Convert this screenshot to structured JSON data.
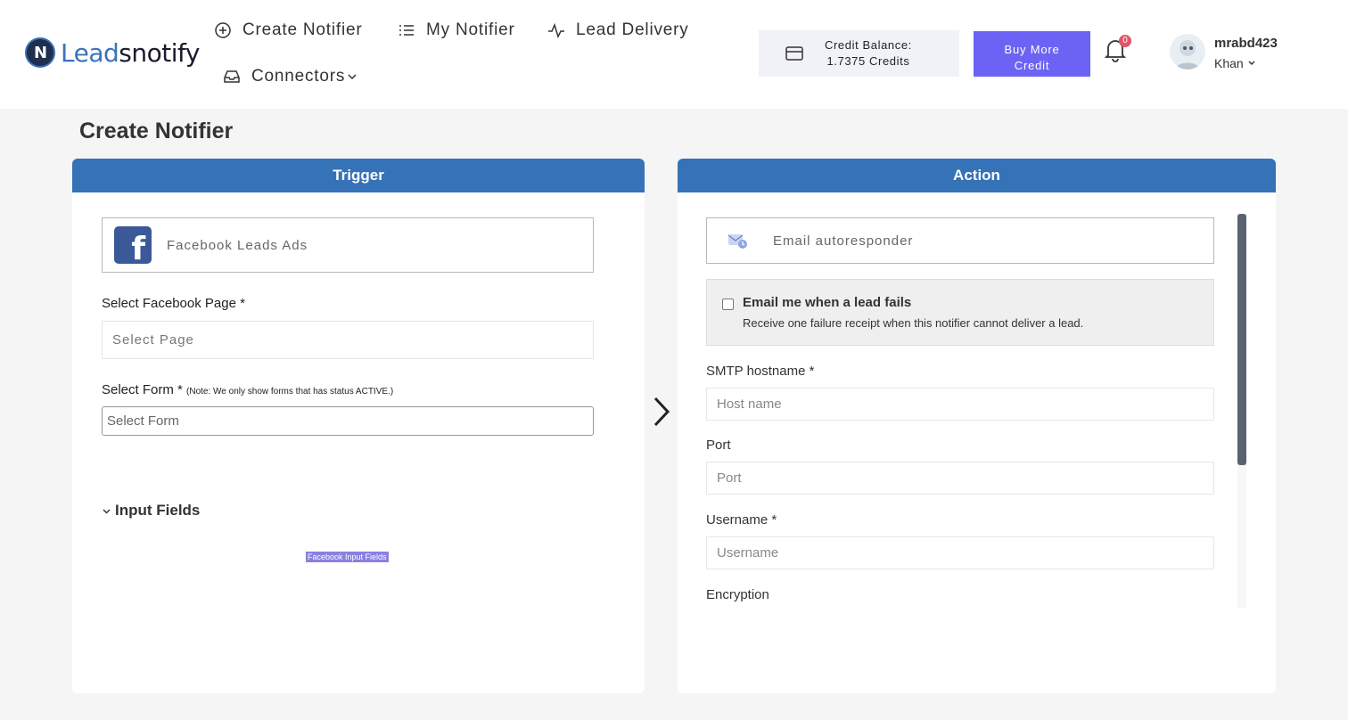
{
  "brand": {
    "part1": "Lead",
    "part2": "snotify",
    "mark": "N"
  },
  "nav": {
    "create": "Create Notifier",
    "my": "My Notifier",
    "lead": "Lead Delivery",
    "connectors": "Connectors"
  },
  "credit": {
    "line1": "Credit Balance:",
    "line2": "1.7375 Credits"
  },
  "buy": {
    "line1": "Buy More",
    "line2": "Credit"
  },
  "notifications": {
    "count": "0"
  },
  "user": {
    "name": "mrabd423",
    "last": "Khan"
  },
  "page": {
    "title": "Create Notifier"
  },
  "trigger": {
    "header": "Trigger",
    "app": "Facebook Leads Ads",
    "page_label": "Select Facebook Page *",
    "page_placeholder": "Select Page",
    "form_label": "Select Form *",
    "form_note": "(Note: We only show forms that has status ACTIVE.)",
    "form_placeholder": "Select Form",
    "input_fields": "Input Fields",
    "fb_tag": "Facebook Input Fields"
  },
  "action": {
    "header": "Action",
    "app": "Email autoresponder",
    "fail_title": "Email me when a lead fails",
    "fail_desc": "Receive one failure receipt when this notifier cannot deliver a lead.",
    "smtp_label": "SMTP hostname *",
    "smtp_placeholder": "Host name",
    "port_label": "Port",
    "port_placeholder": "Port",
    "user_label": "Username *",
    "user_placeholder": "Username",
    "enc_label": "Encryption"
  },
  "colors": {
    "accent": "#3672b7",
    "button": "#6c63f5",
    "badge": "#e0556b"
  }
}
